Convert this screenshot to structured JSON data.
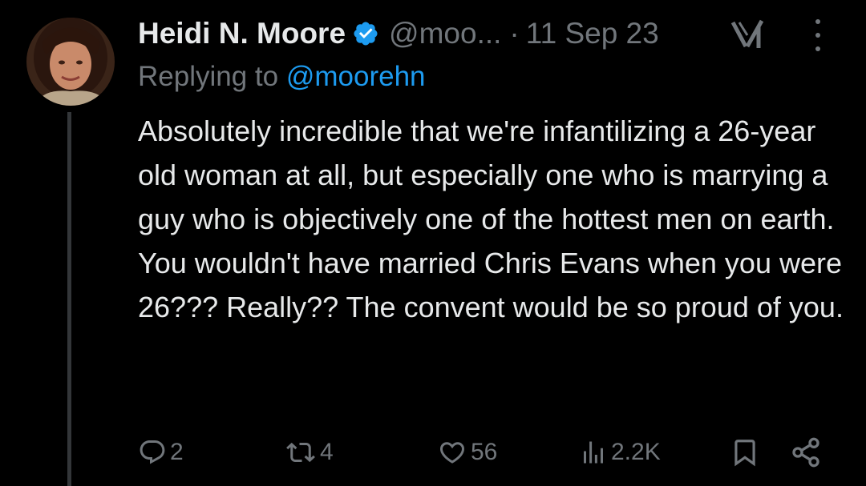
{
  "tweet": {
    "display_name": "Heidi N. Moore",
    "handle": "@moo...",
    "separator": "·",
    "date": "11 Sep 23",
    "replying_prefix": "Replying to ",
    "replying_to": "@moorehn",
    "text": "Absolutely incredible that we're infantilizing a 26-year old woman at all, but especially one who is marrying a guy who is objectively one of the hottest men on earth. You wouldn't have married Chris Evans when you were 26??? Really?? The convent would be so proud of you."
  },
  "actions": {
    "replies": "2",
    "reposts": "4",
    "likes": "56",
    "views": "2.2K"
  },
  "colors": {
    "background": "#000000",
    "text": "#e7e9ea",
    "secondary": "#71767b",
    "accent": "#1d9bf0"
  },
  "icons": [
    "verified-badge-icon",
    "grok-icon",
    "more-icon",
    "reply-icon",
    "repost-icon",
    "like-icon",
    "views-icon",
    "bookmark-icon",
    "share-icon"
  ]
}
